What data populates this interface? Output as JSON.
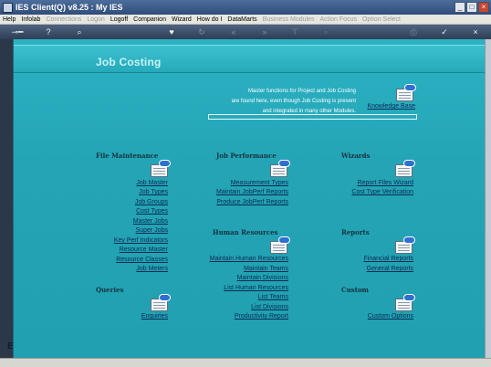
{
  "window": {
    "title": "IES Client(Q) v8.25 : My IES"
  },
  "window_controls": [
    "_",
    "□",
    "×"
  ],
  "menu": [
    {
      "label": "Help",
      "enabled": true
    },
    {
      "label": "Infolab",
      "enabled": true
    },
    {
      "label": "Connections",
      "enabled": false
    },
    {
      "label": "Logon",
      "enabled": false
    },
    {
      "label": "Logoff",
      "enabled": true
    },
    {
      "label": "Companion",
      "enabled": true
    },
    {
      "label": "Wizard",
      "enabled": true
    },
    {
      "label": "How do I",
      "enabled": true
    },
    {
      "label": "DataMarts",
      "enabled": true
    },
    {
      "label": "Business Modules",
      "enabled": false
    },
    {
      "label": "Action Focus",
      "enabled": false
    },
    {
      "label": "Option Select",
      "enabled": false
    }
  ],
  "toolbar_icons": [
    "key-icon",
    "help-icon",
    "search-icon",
    "heart-icon",
    "refresh-icon",
    "rewind-icon",
    "fast-forward-icon",
    "last-icon",
    "stop-icon",
    "print-icon",
    "ok-icon",
    "close-icon"
  ],
  "page": {
    "title": "Job Costing",
    "intro_lines": [
      "Master functions for Project and Job Costing",
      "are found here, even though Job Costing is present",
      "and integrated in many other Modules."
    ],
    "knowledge_base": "Knowledge Base"
  },
  "sections": {
    "file_maintenance": {
      "title": "File Maintenance",
      "links": [
        "Job Master",
        "Job Types",
        "Job Groups",
        "Cost Types",
        "Master Jobs",
        "Super Jobs",
        "Key Perf Indicators",
        "Resource Master",
        "Resource Classes",
        "Job Meters"
      ]
    },
    "job_performance": {
      "title": "Job Performance",
      "links": [
        "Measurement Types",
        "Maintain JobPerf Reports",
        "Produce JobPerf Reports"
      ]
    },
    "wizards": {
      "title": "Wizards",
      "links": [
        "Report Files Wizard",
        "Cost Type Verification"
      ]
    },
    "human_resources": {
      "title": "Human Resources",
      "links": [
        "Maintain Human Resources",
        "Maintain Teams",
        "Maintain Divisions",
        "List Human Resources",
        "List Teams",
        "List Divisions",
        "Productivity Report"
      ]
    },
    "reports": {
      "title": "Reports",
      "links": [
        "Financial Reports",
        "General Reports"
      ]
    },
    "queries": {
      "title": "Queries",
      "links": [
        "Enquiries"
      ]
    },
    "custom": {
      "title": "Custom",
      "links": [
        "Custom Options"
      ]
    }
  },
  "left_edge_letter": "E"
}
